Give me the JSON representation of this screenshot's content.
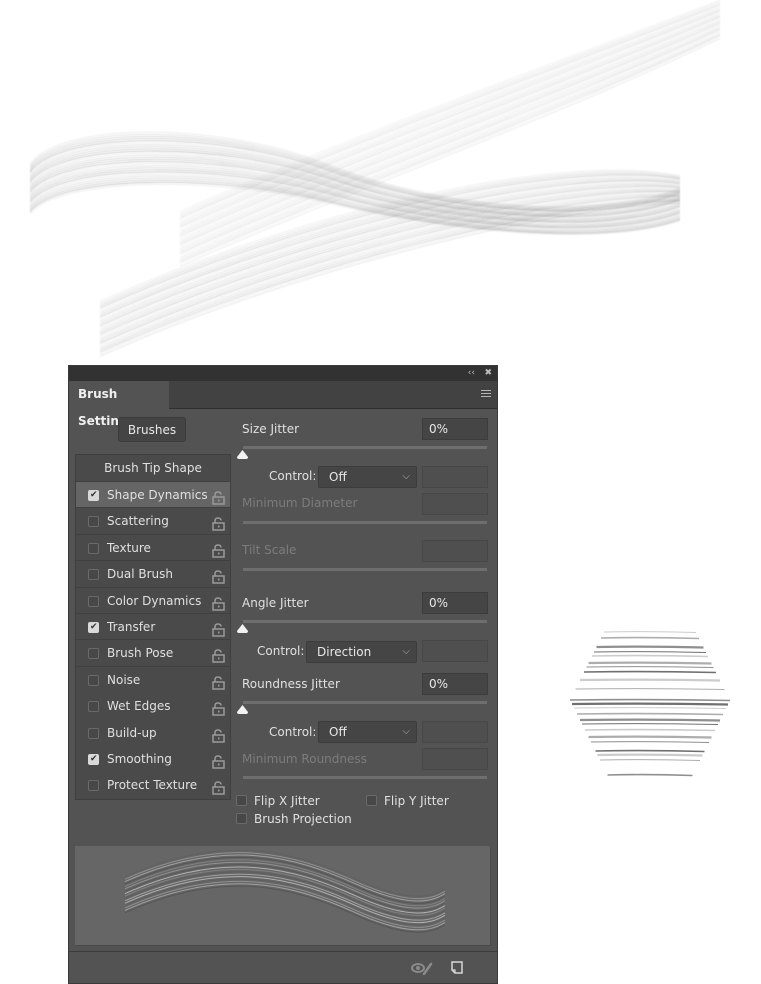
{
  "panel": {
    "title": "Brush Settings",
    "collapse_icon": "double-chevron-left",
    "close_icon": "close-x",
    "menu_icon": "hamburger-menu",
    "brushes_button": "Brushes",
    "options_header": "Brush Tip Shape",
    "options": [
      {
        "label": "Shape Dynamics",
        "checked": true,
        "selected": true
      },
      {
        "label": "Scattering",
        "checked": false
      },
      {
        "label": "Texture",
        "checked": false
      },
      {
        "label": "Dual Brush",
        "checked": false
      },
      {
        "label": "Color Dynamics",
        "checked": false
      },
      {
        "label": "Transfer",
        "checked": true
      },
      {
        "label": "Brush Pose",
        "checked": false
      },
      {
        "label": "Noise",
        "checked": false
      },
      {
        "label": "Wet Edges",
        "checked": false
      },
      {
        "label": "Build-up",
        "checked": false
      },
      {
        "label": "Smoothing",
        "checked": true
      },
      {
        "label": "Protect Texture",
        "checked": false
      }
    ],
    "settings": {
      "size_jitter": {
        "label": "Size Jitter",
        "value": "0%",
        "slider_percent": 0
      },
      "size_control": {
        "label": "Control:",
        "value": "Off"
      },
      "minimum_diameter": {
        "label": "Minimum Diameter",
        "value": ""
      },
      "tilt_scale": {
        "label": "Tilt Scale",
        "value": ""
      },
      "angle_jitter": {
        "label": "Angle Jitter",
        "value": "0%",
        "slider_percent": 0
      },
      "angle_control": {
        "label": "Control:",
        "value": "Direction"
      },
      "roundness_jitter": {
        "label": "Roundness Jitter",
        "value": "0%",
        "slider_percent": 0
      },
      "roundness_control": {
        "label": "Control:",
        "value": "Off"
      },
      "minimum_roundness": {
        "label": "Minimum Roundness",
        "value": ""
      },
      "flip_x": {
        "label": "Flip X Jitter",
        "checked": false
      },
      "flip_y": {
        "label": "Flip Y Jitter",
        "checked": false
      },
      "brush_projection": {
        "label": "Brush Projection",
        "checked": false
      }
    },
    "bottom_icons": [
      "toggle-live-tip-preview",
      "create-new-brush"
    ]
  },
  "colors": {
    "panel_bg": "#535353",
    "titlebar_bg": "#323232",
    "tabrow_bg": "#424242",
    "preview_bg": "#666666",
    "text": "#e0e0e0",
    "dim_text": "#7c7c7c"
  }
}
